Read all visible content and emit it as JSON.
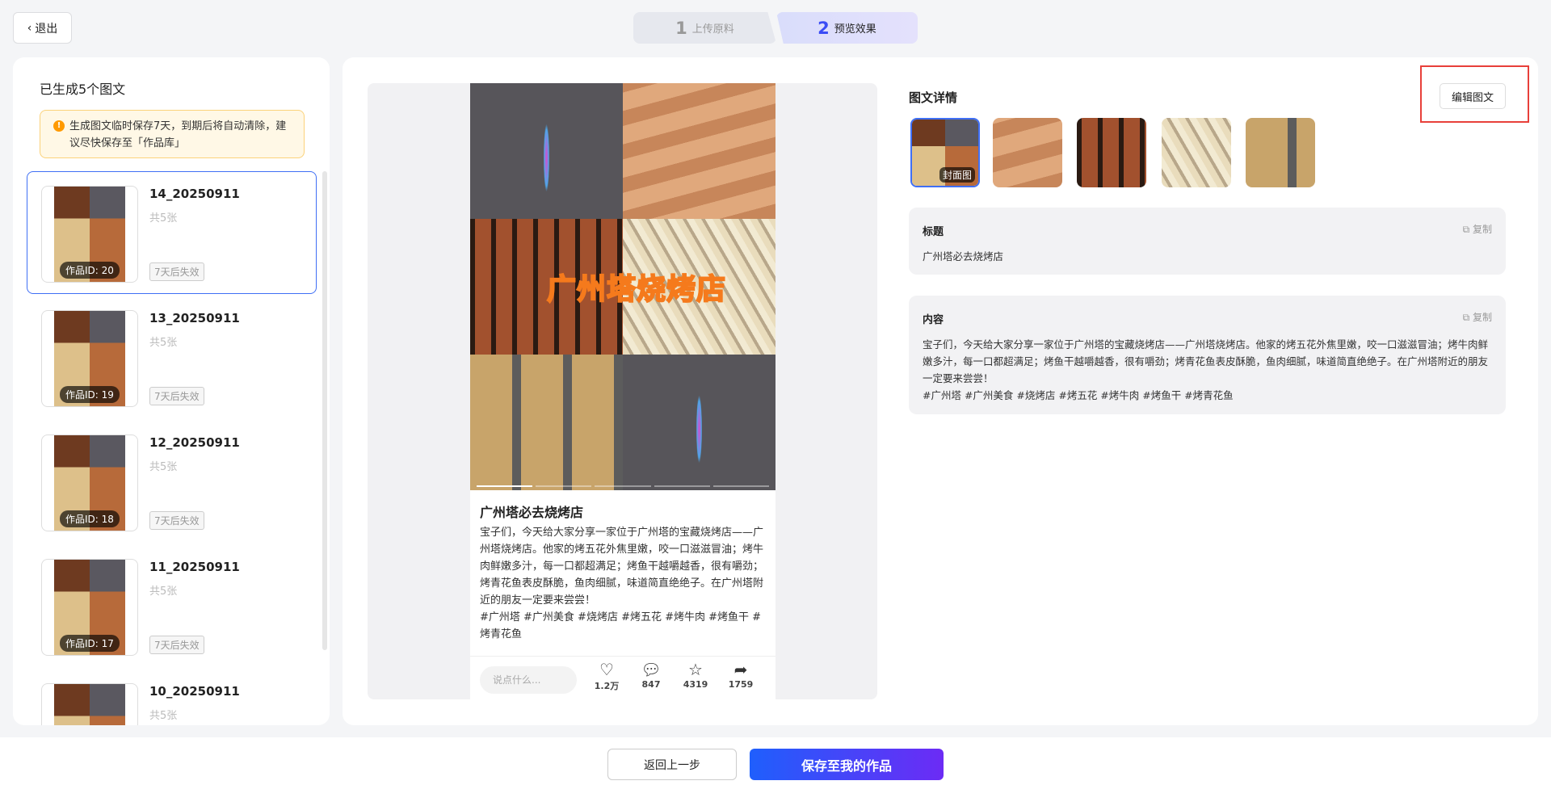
{
  "header": {
    "exit_label": "退出",
    "steps": [
      {
        "num": "1",
        "label": "上传原料"
      },
      {
        "num": "2",
        "label": "预览效果"
      }
    ]
  },
  "sidebar": {
    "title": "已生成5个图文",
    "notice": "生成图文临时保存7天，到期后将自动清除，建议尽快保存至「作品库」",
    "items": [
      {
        "name": "14_20250911",
        "count": "共5张",
        "id_tag": "作品ID: 20",
        "expire": "7天后失效"
      },
      {
        "name": "13_20250911",
        "count": "共5张",
        "id_tag": "作品ID: 19",
        "expire": "7天后失效"
      },
      {
        "name": "12_20250911",
        "count": "共5张",
        "id_tag": "作品ID: 18",
        "expire": "7天后失效"
      },
      {
        "name": "11_20250911",
        "count": "共5张",
        "id_tag": "作品ID: 17",
        "expire": "7天后失效"
      },
      {
        "name": "10_20250911",
        "count": "共5张"
      }
    ]
  },
  "preview": {
    "overlay_text": "广州塔烧烤店",
    "title": "广州塔必去烧烤店",
    "body": "宝子们，今天给大家分享一家位于广州塔的宝藏烧烤店——广州塔烧烤店。他家的烤五花外焦里嫩，咬一口滋滋冒油；烤牛肉鲜嫩多汁，每一口都超满足；烤鱼干越嚼越香，很有嚼劲；烤青花鱼表皮酥脆，鱼肉细腻，味道简直绝绝子。在广州塔附近的朋友一定要来尝尝！\n#广州塔 #广州美食 #烧烤店 #烤五花 #烤牛肉 #烤鱼干 #烤青花鱼",
    "comment_placeholder": "说点什么...",
    "likes": "1.2万",
    "comments": "847",
    "stars": "4319",
    "shares": "1759"
  },
  "details": {
    "heading": "图文详情",
    "edit_label": "编辑图文",
    "cover_label": "封面图",
    "copy_label": "复制",
    "title_label": "标题",
    "title_value": "广州塔必去烧烤店",
    "content_label": "内容",
    "content_value": "宝子们，今天给大家分享一家位于广州塔的宝藏烧烤店——广州塔烧烤店。他家的烤五花外焦里嫩，咬一口滋滋冒油；烤牛肉鲜嫩多汁，每一口都超满足；烤鱼干越嚼越香，很有嚼劲；烤青花鱼表皮酥脆，鱼肉细腻，味道简直绝绝子。在广州塔附近的朋友一定要来尝尝！\n#广州塔 #广州美食 #烧烤店 #烤五花 #烤牛肉 #烤鱼干 #烤青花鱼"
  },
  "footer": {
    "back_label": "返回上一步",
    "save_label": "保存至我的作品"
  }
}
